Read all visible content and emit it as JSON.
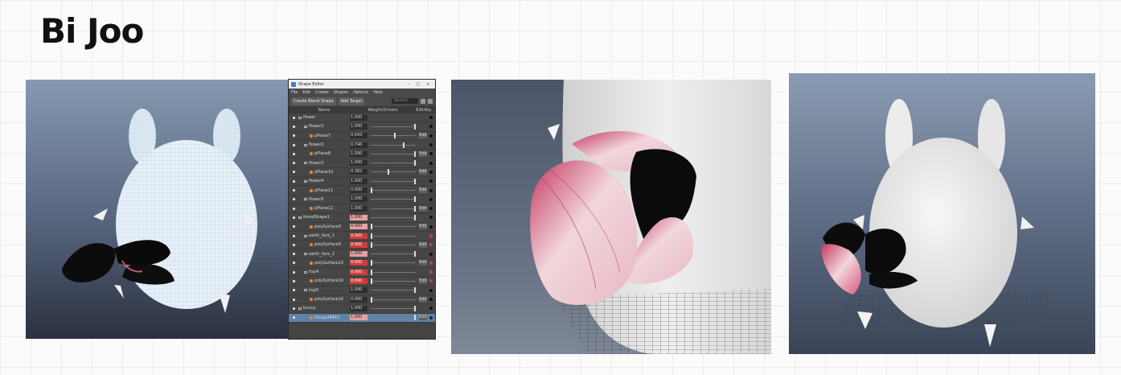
{
  "page": {
    "title": "Bi Joo"
  },
  "shape_editor": {
    "window_title": "Shape Editor",
    "menu": [
      "File",
      "Edit",
      "Create",
      "Shapes",
      "Options",
      "Help"
    ],
    "toolbar": {
      "create_blend_shape": "Create Blend Shape",
      "add_target": "Add Target",
      "search_placeholder": "Search"
    },
    "columns": {
      "name": "Name",
      "weight": "Weight/Drivers",
      "edit": "Edit",
      "key": "Key"
    },
    "rows": [
      {
        "name": "flower",
        "level": 0,
        "kind": "group",
        "weight": "1.000",
        "wstyle": "",
        "slider": null,
        "edit": "",
        "key": "black"
      },
      {
        "name": "flower1",
        "level": 1,
        "kind": "group",
        "weight": "1.000",
        "wstyle": "",
        "slider": 1.0,
        "edit": "",
        "key": "black"
      },
      {
        "name": "pPlane7",
        "level": 2,
        "kind": "target",
        "weight": "0.543",
        "wstyle": "",
        "slider": 0.543,
        "edit": "Edit",
        "key": "black"
      },
      {
        "name": "flower2",
        "level": 1,
        "kind": "group",
        "weight": "0.746",
        "wstyle": "",
        "slider": 0.746,
        "edit": "",
        "key": "black"
      },
      {
        "name": "pPlane8",
        "level": 2,
        "kind": "target",
        "weight": "1.000",
        "wstyle": "",
        "slider": 1.0,
        "edit": "Edit",
        "key": "black"
      },
      {
        "name": "flower3",
        "level": 1,
        "kind": "group",
        "weight": "1.000",
        "wstyle": "",
        "slider": 1.0,
        "edit": "",
        "key": "black"
      },
      {
        "name": "pPlane10",
        "level": 2,
        "kind": "target",
        "weight": "0.382",
        "wstyle": "",
        "slider": 0.382,
        "edit": "Edit",
        "key": "black"
      },
      {
        "name": "flower4",
        "level": 1,
        "kind": "group",
        "weight": "1.000",
        "wstyle": "",
        "slider": 1.0,
        "edit": "",
        "key": "black"
      },
      {
        "name": "pPlane11",
        "level": 2,
        "kind": "target",
        "weight": "0.000",
        "wstyle": "",
        "slider": 0.0,
        "edit": "Edit",
        "key": "black"
      },
      {
        "name": "flower5",
        "level": 1,
        "kind": "group",
        "weight": "1.000",
        "wstyle": "",
        "slider": 1.0,
        "edit": "",
        "key": "black"
      },
      {
        "name": "pPlane12",
        "level": 2,
        "kind": "target",
        "weight": "1.000",
        "wstyle": "",
        "slider": 1.0,
        "edit": "Edit",
        "key": "black"
      },
      {
        "name": "blendShape1",
        "level": 0,
        "kind": "group",
        "weight": "1.000",
        "wstyle": "pink",
        "slider": 1.0,
        "edit": "",
        "key": "black"
      },
      {
        "name": "polySurface9",
        "level": 2,
        "kind": "target",
        "weight": "0.000",
        "wstyle": "pink",
        "slider": 0.0,
        "edit": "Edit",
        "key": "black"
      },
      {
        "name": "earth_fans_1",
        "level": 1,
        "kind": "group",
        "weight": "0.000",
        "wstyle": "red",
        "slider": 0.0,
        "edit": "",
        "key": "red"
      },
      {
        "name": "polySurface9",
        "level": 2,
        "kind": "target",
        "weight": "0.000",
        "wstyle": "red",
        "slider": 0.0,
        "edit": "Edit",
        "key": "red"
      },
      {
        "name": "earth_fans_2",
        "level": 1,
        "kind": "group",
        "weight": "1.000",
        "wstyle": "pink",
        "slider": 1.0,
        "edit": "",
        "key": "black"
      },
      {
        "name": "polySurface13",
        "level": 2,
        "kind": "target",
        "weight": "0.000",
        "wstyle": "red",
        "slider": 0.0,
        "edit": "Edit",
        "key": "red"
      },
      {
        "name": "hsp4",
        "level": 1,
        "kind": "group",
        "weight": "0.000",
        "wstyle": "red",
        "slider": 0.0,
        "edit": "",
        "key": "red"
      },
      {
        "name": "polySurface10",
        "level": 2,
        "kind": "target",
        "weight": "0.000",
        "wstyle": "red",
        "slider": 0.0,
        "edit": "Edit",
        "key": "red"
      },
      {
        "name": "hsp5",
        "level": 1,
        "kind": "group",
        "weight": "1.000",
        "wstyle": "",
        "slider": 1.0,
        "edit": "",
        "key": "black"
      },
      {
        "name": "polySurface10",
        "level": 2,
        "kind": "target",
        "weight": "0.000",
        "wstyle": "",
        "slider": 0.0,
        "edit": "Edit",
        "key": "black"
      },
      {
        "name": "bunny",
        "level": 0,
        "kind": "group",
        "weight": "1.000",
        "wstyle": "",
        "slider": 1.0,
        "edit": "",
        "key": "black"
      },
      {
        "name": "Group28442",
        "level": 2,
        "kind": "target",
        "weight": "1.000",
        "wstyle": "pink",
        "slider": 1.0,
        "edit": "Edit",
        "key": "blue",
        "selected": true
      }
    ]
  },
  "colors": {
    "accent_red": "#d23c3c",
    "selection": "#5c84a8",
    "petal_pink": "#d9597f",
    "petal_dark": "#0c0c0c"
  }
}
